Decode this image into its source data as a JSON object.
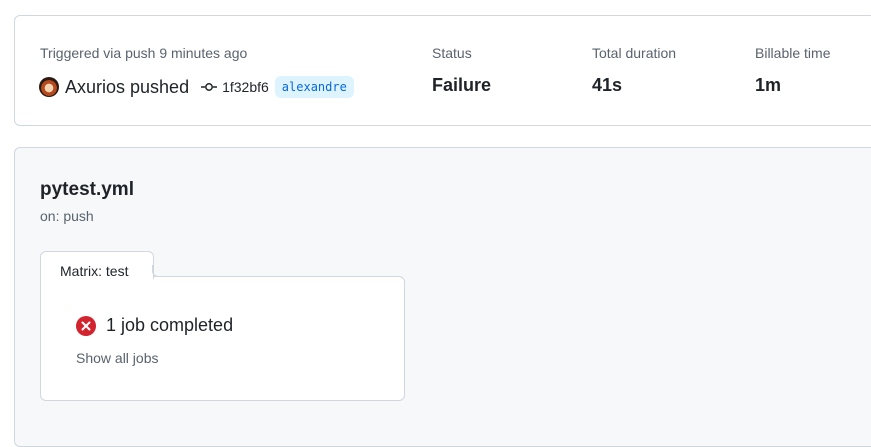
{
  "summary": {
    "trigger_text": "Triggered via push 9 minutes ago",
    "actor": "Axurios pushed",
    "commit_sha": "1f32bf6",
    "branch": "alexandre",
    "status_label": "Status",
    "status_value": "Failure",
    "duration_label": "Total duration",
    "duration_value": "41s",
    "billable_label": "Billable time",
    "billable_value": "1m"
  },
  "workflow": {
    "name": "pytest.yml",
    "trigger": "on: push",
    "matrix_tab_label": "Matrix: test",
    "job_summary": "1 job completed",
    "show_all_label": "Show all jobs"
  },
  "icons": {
    "avatar": "avatar",
    "commit": "git-commit-icon",
    "failure": "x-circle-fill-icon"
  },
  "colors": {
    "failure": "#d1242f",
    "branch_text": "#0969da",
    "branch_bg": "#ddf4ff",
    "muted_text": "#59636e",
    "border": "#d0d7de",
    "panel_bg": "#f6f8fa"
  }
}
